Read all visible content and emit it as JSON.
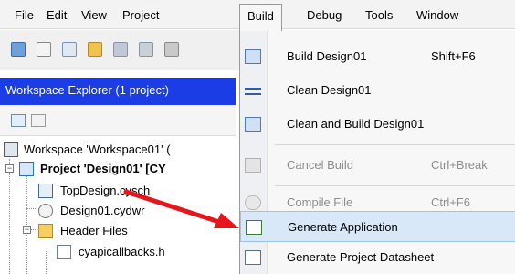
{
  "menubar": {
    "items": [
      {
        "label": "File",
        "accel": "F"
      },
      {
        "label": "Edit",
        "accel": "E"
      },
      {
        "label": "View",
        "accel": "V"
      },
      {
        "label": "Project",
        "accel": "P"
      },
      {
        "label": "Build",
        "accel": "B"
      },
      {
        "label": "Debug",
        "accel": "D"
      },
      {
        "label": "Tools",
        "accel": "T"
      },
      {
        "label": "Window",
        "accel": "W"
      }
    ]
  },
  "workspace": {
    "header": "Workspace Explorer (1 project)",
    "tree": {
      "workspace": "Workspace 'Workspace01' (",
      "project": "Project  'Design01' [CY",
      "topdesign": "TopDesign.cysch",
      "dwr": "Design01.cydwr",
      "header_files": "Header Files",
      "file": "cyapicallbacks.h"
    }
  },
  "build_menu": {
    "items": [
      {
        "label": "Build Design01",
        "shortcut": "Shift+F6",
        "enabled": true,
        "icon": "build-icon"
      },
      {
        "label": "Clean Design01",
        "shortcut": "",
        "enabled": true,
        "icon": "clean-icon"
      },
      {
        "label": "Clean and Build Design01",
        "shortcut": "",
        "enabled": true,
        "icon": "clean-build-icon"
      },
      {
        "label": "Cancel Build",
        "shortcut": "Ctrl+Break",
        "enabled": false,
        "icon": "cancel-build-icon"
      },
      {
        "label": "Compile File",
        "shortcut": "Ctrl+F6",
        "enabled": false,
        "icon": "compile-file-icon"
      },
      {
        "label": "Generate Application",
        "shortcut": "",
        "enabled": true,
        "highlighted": true,
        "icon": "generate-application-icon"
      },
      {
        "label": "Generate Project Datasheet",
        "shortcut": "",
        "enabled": true,
        "icon": "datasheet-icon"
      }
    ]
  },
  "colors": {
    "header_blue": "#1a3de6",
    "highlight": "#d8e8f9",
    "arrow_red": "#e8161c"
  }
}
